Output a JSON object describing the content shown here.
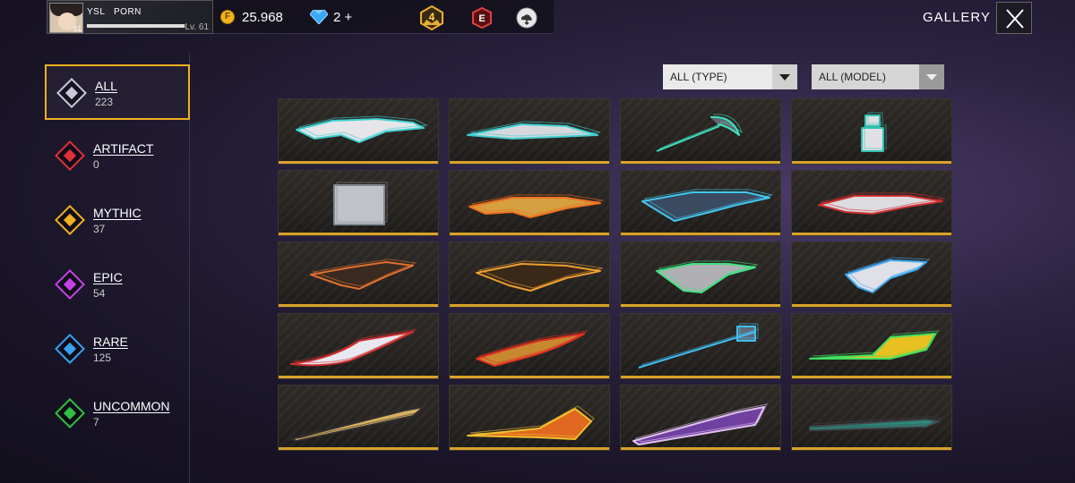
{
  "player": {
    "name_part1": "YSL",
    "name_part2": "PORN",
    "avatar_level": "61",
    "level_label": "Lv. 61",
    "xp_progress": 0.99
  },
  "currency": {
    "coins": "25.968",
    "diamonds": "2 +",
    "rank": "4",
    "elite_badge": "E"
  },
  "header": {
    "title": "GALLERY",
    "close_icon": "close-icon"
  },
  "categories": [
    {
      "label": "ALL",
      "count": "223",
      "gem_color": "#c8c8d8",
      "active": true
    },
    {
      "label": "ARTIFACT",
      "count": "0",
      "gem_color": "#e0303a",
      "active": false
    },
    {
      "label": "MYTHIC",
      "count": "37",
      "gem_color": "#f0b020",
      "active": false
    },
    {
      "label": "EPIC",
      "count": "54",
      "gem_color": "#c840e8",
      "active": false
    },
    {
      "label": "RARE",
      "count": "125",
      "gem_color": "#3aa0f0",
      "active": false
    },
    {
      "label": "UNCOMMON",
      "count": "7",
      "gem_color": "#30c040",
      "active": false
    }
  ],
  "filters": {
    "type_selected": "ALL (TYPE)",
    "model_selected": "ALL (MODEL)"
  },
  "items": [
    {
      "icon": "white-sniper-rifle-icon",
      "color": "#e6e6ea",
      "accent": "#40d0d0"
    },
    {
      "icon": "white-crossbow-icon",
      "color": "#d8d8dc",
      "accent": "#40d0d0"
    },
    {
      "icon": "scythe-icon",
      "color": "#606870",
      "accent": "#40e0c0"
    },
    {
      "icon": "gourd-bottle-icon",
      "color": "#e0e0e4",
      "accent": "#30c0b0"
    },
    {
      "icon": "armored-backpack-icon",
      "color": "#bfc2c8",
      "accent": "#808890"
    },
    {
      "icon": "golden-sniper-rifle-icon",
      "color": "#d4a040",
      "accent": "#f07020"
    },
    {
      "icon": "cyber-assault-rifle-icon",
      "color": "#3a4a60",
      "accent": "#40c8f0"
    },
    {
      "icon": "white-red-rifle-icon",
      "color": "#dcdce0",
      "accent": "#d03030"
    },
    {
      "icon": "dragon-smg-icon",
      "color": "#3a2a20",
      "accent": "#e07030"
    },
    {
      "icon": "flame-assault-rifle-icon",
      "color": "#3a2818",
      "accent": "#f0a030"
    },
    {
      "icon": "green-energy-rifle-icon",
      "color": "#b0b0b4",
      "accent": "#40e080"
    },
    {
      "icon": "blue-dragon-pistol-icon",
      "color": "#e0e0e8",
      "accent": "#40a8f0"
    },
    {
      "icon": "ice-fire-blade-icon",
      "color": "#e8e8f0",
      "accent": "#d03030"
    },
    {
      "icon": "golden-machete-icon",
      "color": "#c88830",
      "accent": "#e03020"
    },
    {
      "icon": "neon-staff-icon",
      "color": "#606878",
      "accent": "#40c0f0"
    },
    {
      "icon": "golden-green-axe-icon",
      "color": "#e8c020",
      "accent": "#40e060"
    },
    {
      "icon": "golden-spear-icon",
      "color": "#d8b060",
      "accent": "#303030"
    },
    {
      "icon": "fire-dragon-blade-icon",
      "color": "#e06820",
      "accent": "#f0c030"
    },
    {
      "icon": "purple-bat-icon",
      "color": "#7040a0",
      "accent": "#e0c0f0"
    },
    {
      "icon": "teal-katana-icon",
      "color": "#2a8a78",
      "accent": "#404850"
    }
  ]
}
